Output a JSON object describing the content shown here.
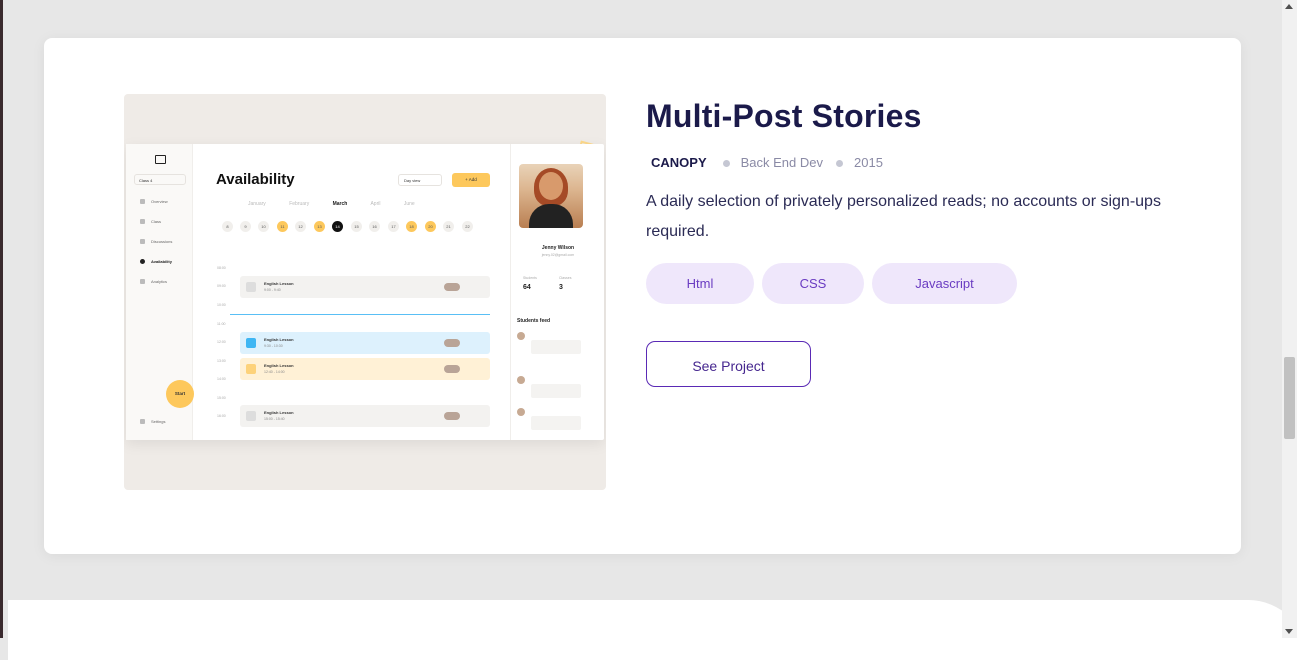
{
  "project": {
    "title": "Multi-Post Stories",
    "client": "CANOPY",
    "role": "Back End Dev",
    "year": "2015",
    "description": "A daily selection of privately personalized reads; no accounts or sign-ups required.",
    "tags": [
      "Html",
      "CSS",
      "Javascript"
    ],
    "cta_label": "See Project"
  },
  "preview": {
    "sidebar": {
      "class_select": "Class 4",
      "items": [
        "Overview",
        "Class",
        "Discussions",
        "Availability",
        "Analytics"
      ],
      "settings": "Settings",
      "start": "Start"
    },
    "heading": "Availability",
    "day_view": "Day view",
    "add_label": "+ Add",
    "months": [
      "January",
      "February",
      "March",
      "April",
      "June"
    ],
    "days": [
      "8",
      "9",
      "10",
      "11",
      "12",
      "13",
      "14",
      "15",
      "16",
      "17",
      "18",
      "20",
      "21",
      "22"
    ],
    "times": [
      "08:00",
      "09:00",
      "10:00",
      "11:00",
      "12:00",
      "13:00",
      "14:00",
      "15:00",
      "16:00"
    ],
    "lessons": [
      {
        "title": "English Lesson",
        "time": "9:00 - 9:40"
      },
      {
        "title": "English Lesson",
        "time": "9:30 - 10:30"
      },
      {
        "title": "English Lesson",
        "time": "12:40 - 14:00"
      },
      {
        "title": "English Lesson",
        "time": "15:00 - 15:40"
      }
    ],
    "profile": {
      "name": "Jenny Wilson",
      "email": "jenny.02@gmail.com",
      "students_label": "Students",
      "students_value": "64",
      "classes_label": "Classes",
      "classes_value": "3",
      "feed_title": "Students feed"
    }
  },
  "colors": {
    "title": "#1b1a4a",
    "tag_bg": "#efe7fb",
    "tag_text": "#6a3cc2",
    "cta_border": "#5a2ab5",
    "accent_yellow": "#fdc85c"
  }
}
